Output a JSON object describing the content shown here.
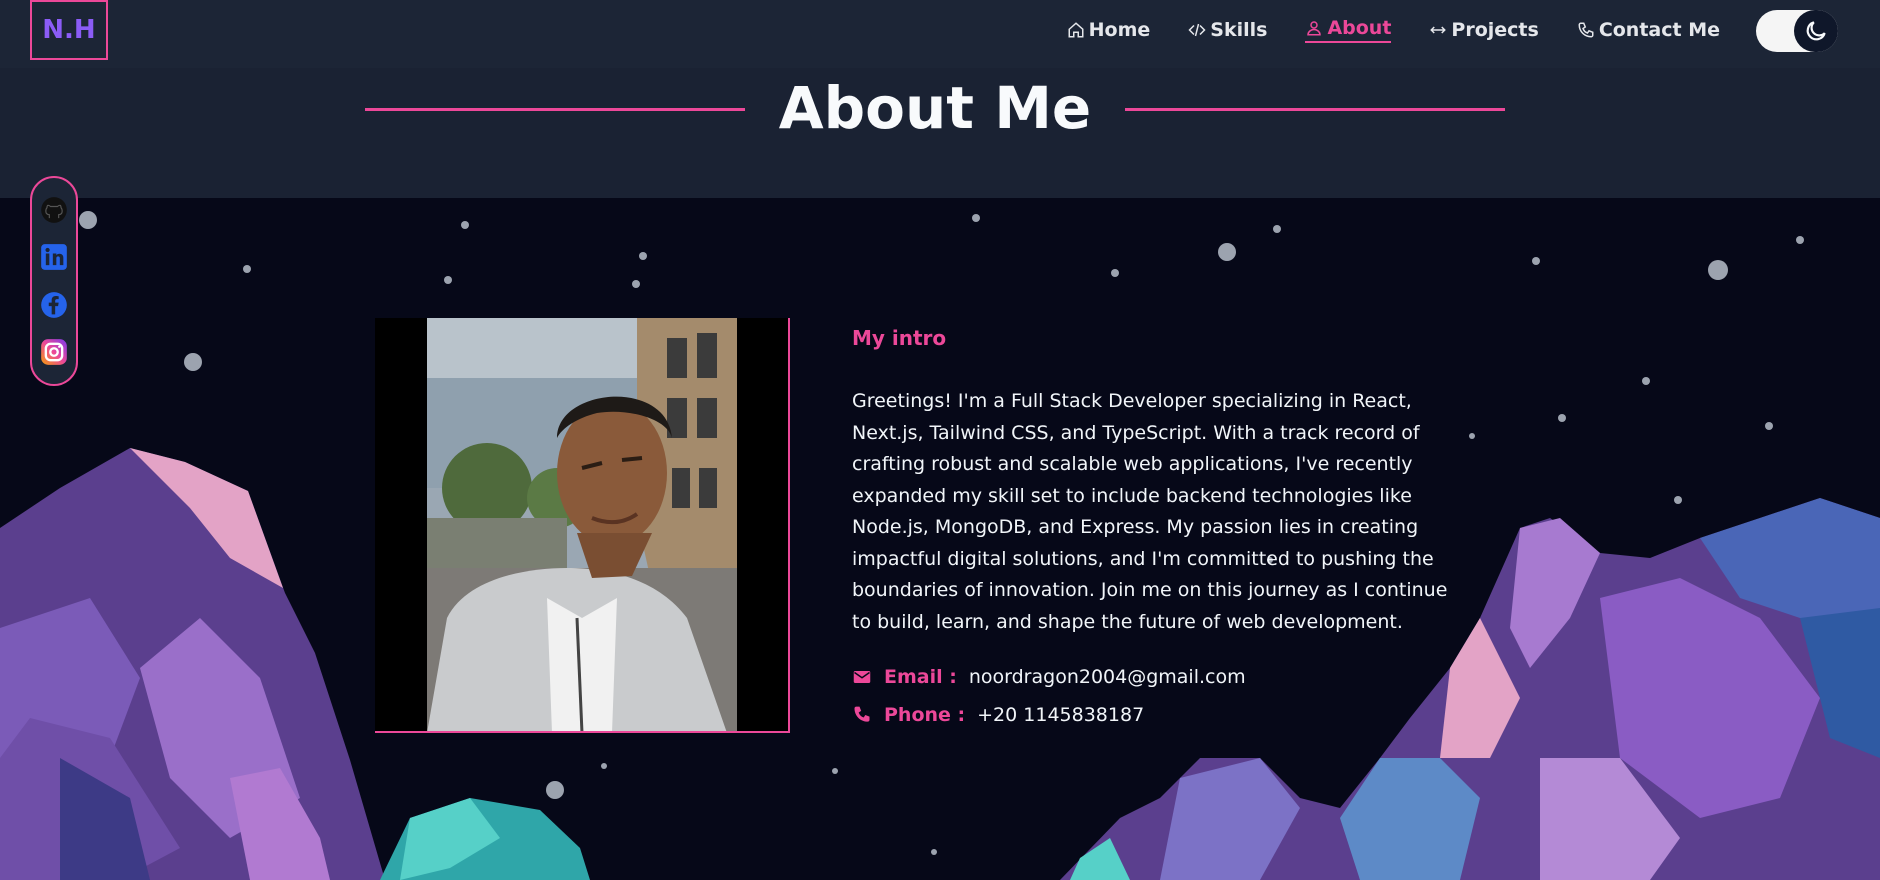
{
  "nav": {
    "logo": "N.H",
    "links": [
      {
        "label": "Home",
        "icon": "home-icon"
      },
      {
        "label": "Skills",
        "icon": "code-icon"
      },
      {
        "label": "About",
        "icon": "user-icon",
        "active": true
      },
      {
        "label": "Projects",
        "icon": "arrows-icon"
      },
      {
        "label": "Contact Me",
        "icon": "phone-icon"
      }
    ],
    "theme_toggle_icon": "moon-icon"
  },
  "section": {
    "title": "About Me"
  },
  "social": [
    "github-icon",
    "linkedin-icon",
    "facebook-icon",
    "instagram-icon"
  ],
  "intro": {
    "label": "My intro",
    "text": "Greetings! I'm a Full Stack Developer specializing in React, Next.js, Tailwind CSS, and TypeScript. With a track record of crafting robust and scalable web applications, I've recently expanded my skill set to include backend technologies like Node.js, MongoDB, and Express. My passion lies in creating impactful digital solutions, and I'm committed to pushing the boundaries of innovation. Join me on this journey as I continue to build, learn, and shape the future of web development.",
    "email_label": "Email :",
    "email": "noordragon2004@gmail.com",
    "phone_label": "Phone :",
    "phone": "+20 1145838187"
  },
  "colors": {
    "accent": "#ec4899",
    "logo": "#8b5cf6",
    "nav_bg": "#1c2536",
    "page_bg": "#060818"
  }
}
